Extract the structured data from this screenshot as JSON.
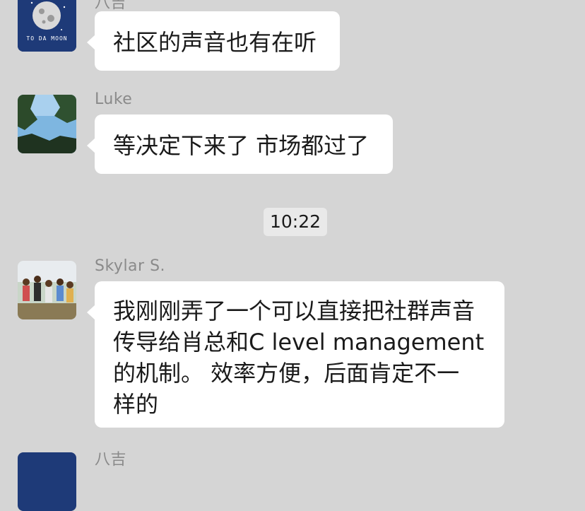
{
  "messages": [
    {
      "sender": "八吉",
      "avatar_icon": "to-da-moon-avatar-icon",
      "avatar_caption": "TO DA MOON",
      "text": "社区的声音也有在听"
    },
    {
      "sender": "Luke",
      "avatar_icon": "sky-trees-avatar-icon",
      "text": "等决定下来了 市场都过了"
    },
    {
      "sender": "Skylar S.",
      "avatar_icon": "group-photo-avatar-icon",
      "lines": [
        "我刚刚弄了一个可以直接把社群声音",
        "传导给肖总和C level management",
        "的机制。 效率方便，后面肯定不一",
        "样的"
      ]
    },
    {
      "sender": "八吉",
      "avatar_icon": "to-da-moon-avatar-icon"
    }
  ],
  "timestamp": "10:22",
  "colors": {
    "background": "#d5d5d5",
    "bubble": "#ffffff",
    "sender_name": "#8a8a8a",
    "time_pill": "#e9e9e9"
  }
}
